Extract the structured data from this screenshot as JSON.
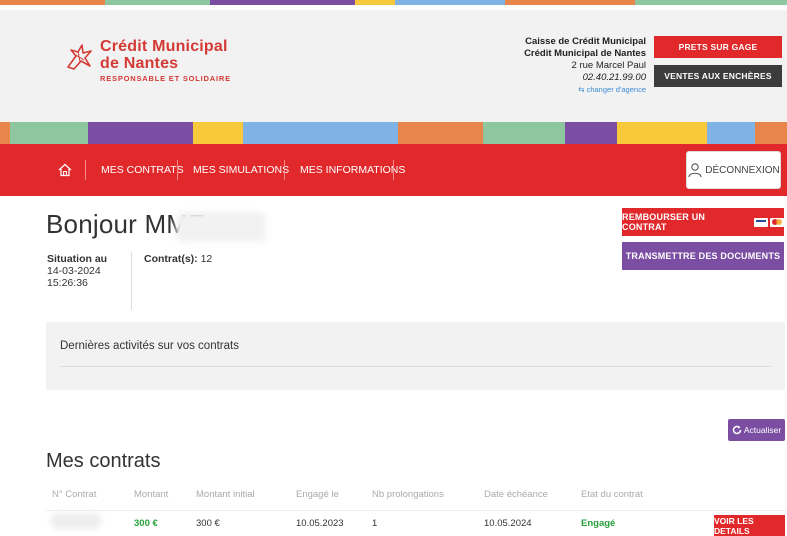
{
  "brand": {
    "name_line1": "Crédit Municipal",
    "name_line2": "de Nantes",
    "tagline": "RESPONSABLE ET SOLIDAIRE",
    "color": "#d43a35"
  },
  "agency": {
    "line1": "Caisse de Crédit Municipal",
    "line2": "Crédit Municipal de Nantes",
    "address": "2 rue Marcel Paul",
    "phone": "02.40.21.99.00",
    "change_link": "changer d'agence"
  },
  "header_buttons": {
    "pawn_loans": "PRETS SUR GAGE",
    "auctions": "VENTES AUX ENCHÈRES"
  },
  "nav": {
    "home_icon": "home-icon",
    "items": [
      "MES CONTRATS",
      "MES SIMULATIONS",
      "MES INFORMATIONS"
    ],
    "logout": "DÉCONNEXION"
  },
  "greeting": "Bonjour MME",
  "situation": {
    "label": "Situation au",
    "date": "14-03-2024",
    "time": "15:26:36",
    "contracts_label": "Contrat(s):",
    "contracts_count": "12"
  },
  "actions": {
    "repay": "REMBOURSER UN CONTRAT",
    "transmit": "TRANSMETTRE DES DOCUMENTS",
    "refresh": "Actualiser"
  },
  "activities": {
    "title": "Dernières activités sur vos contrats"
  },
  "contracts": {
    "title": "Mes contrats",
    "columns": [
      "N° Contrat",
      "Montant",
      "Montant initial",
      "Engagé le",
      "Nb prolongations",
      "Date échéance",
      "Etat du contrat"
    ],
    "rows": [
      {
        "montant": "300 €",
        "montant_initial": "300 €",
        "engage_le": "10.05.2023",
        "nb_prolongations": "1",
        "date_echeance": "10.05.2024",
        "etat": "Engagé",
        "details": "VOIR LES DETAILS"
      }
    ]
  },
  "colors": {
    "red": "#e1292c",
    "dark": "#3c3c3c",
    "purple": "#7b4ea3",
    "green": "#27a03a"
  }
}
